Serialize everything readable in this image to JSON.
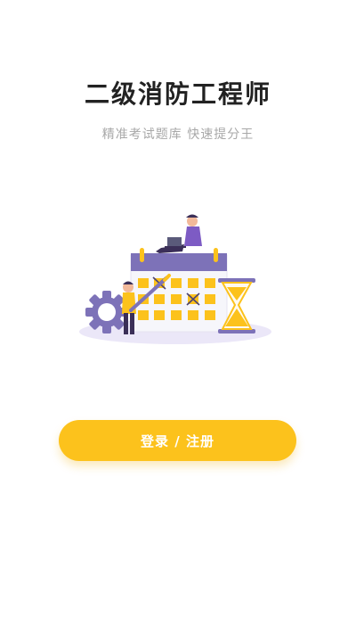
{
  "app": {
    "title": "二级消防工程师",
    "subtitle": "精准考试题库 快速提分王"
  },
  "hero": {
    "icon": "exam-calendar-illustration"
  },
  "actions": {
    "login_register_label": "登录 / 注册"
  },
  "colors": {
    "accent": "#fcc21c",
    "title": "#222222",
    "subtitle": "#a8a8a8",
    "illustration_purple": "#7d72b8"
  }
}
